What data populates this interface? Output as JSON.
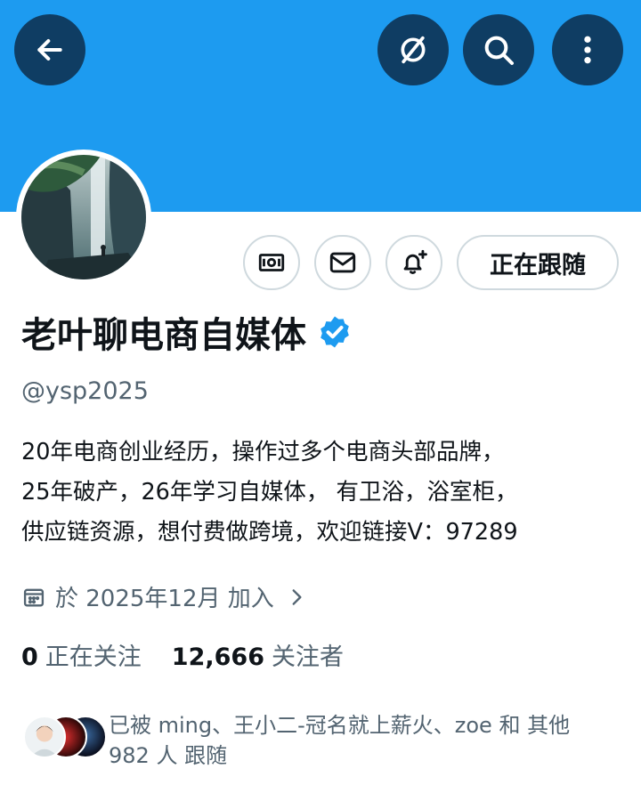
{
  "header": {
    "back_icon": "arrow-left-icon",
    "mute_icon": "slash-circle-icon",
    "search_icon": "search-icon",
    "more_icon": "more-vertical-icon",
    "banner_color": "#1d9bf0"
  },
  "profile": {
    "display_name": "老叶聊电商自媒体",
    "handle": "@ysp2025",
    "verified": true,
    "bio_lines": [
      "20年电商创业经历，操作过多个电商头部品牌，",
      "25年破产，26年学习自媒体， 有卫浴，浴室柜，",
      "供应链资源，想付费做跨境，欢迎链接V：97289"
    ],
    "joined": "於 2025年12月 加入",
    "following_count": "0",
    "following_label": "正在关注",
    "followers_count": "12,666",
    "followers_label": "关注者"
  },
  "actions": {
    "tip_icon": "money-icon",
    "message_icon": "envelope-icon",
    "notify_icon": "bell-plus-icon",
    "follow_label": "正在跟随"
  },
  "followed_by": {
    "line1": "已被 ming、王小二-冠名就上薪火、zoe 和 其他",
    "line2": "982 人 跟随"
  }
}
